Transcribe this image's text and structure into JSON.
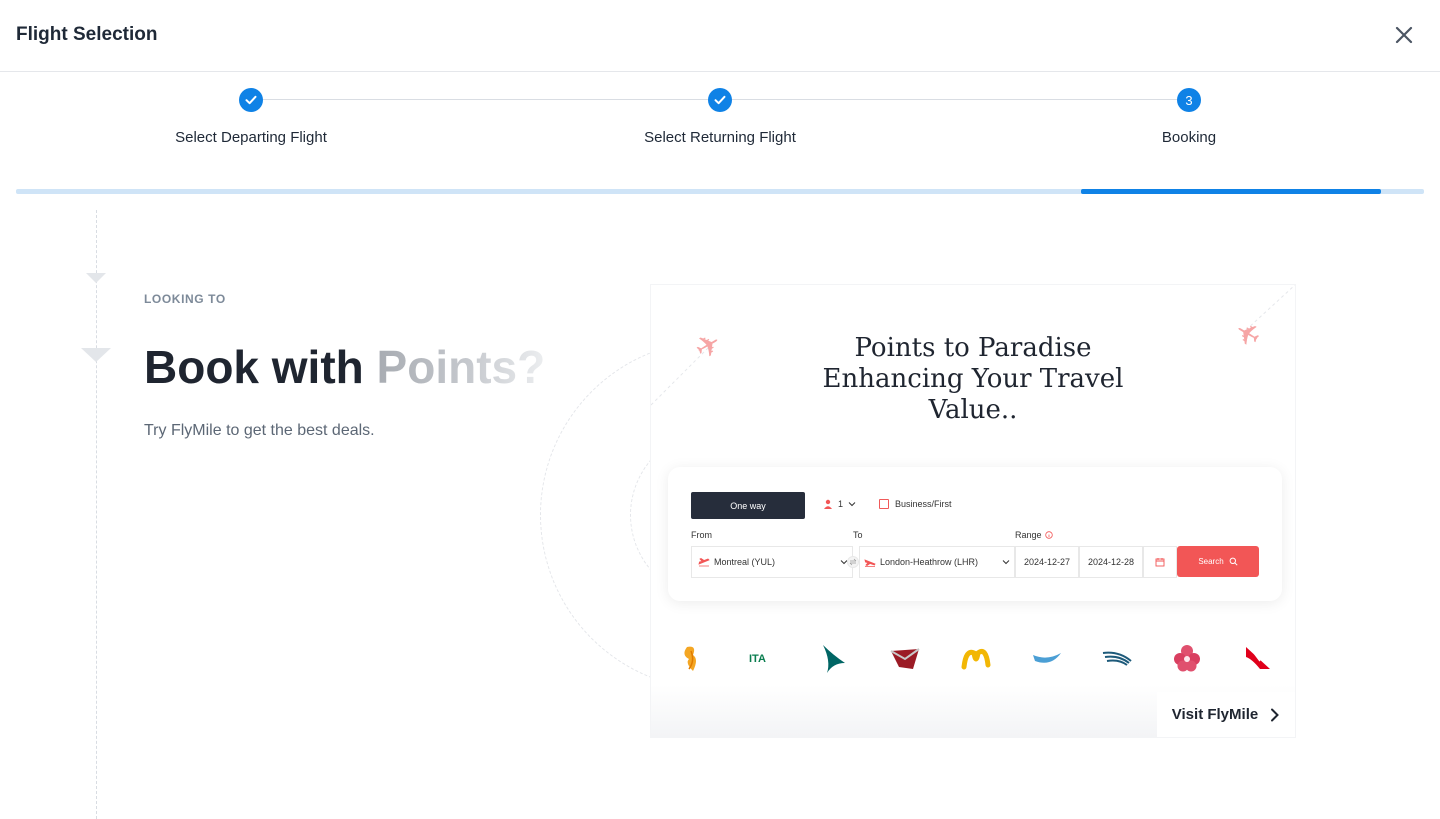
{
  "header": {
    "title": "Flight Selection",
    "close_icon": "close-icon"
  },
  "stepper": {
    "steps": [
      {
        "label": "Select Departing Flight",
        "state": "completed",
        "icon": "check-icon"
      },
      {
        "label": "Select Returning Flight",
        "state": "completed",
        "icon": "check-icon"
      },
      {
        "number": "3",
        "label": "Booking",
        "state": "active"
      }
    ],
    "accent": "#0f82e6"
  },
  "hero": {
    "eyebrow": "LOOKING TO",
    "headline_main": "Book with ",
    "headline_faded": "Points?",
    "subtitle": "Try FlyMile to get the best deals."
  },
  "promo": {
    "title": "Points to Paradise Enhancing Your Travel Value..",
    "widget": {
      "trip_type": "One way",
      "passengers": "1",
      "cabin_option": "Business/First",
      "from_label": "From",
      "to_label": "To",
      "range_label": "Range",
      "from_value": "Montreal (YUL)",
      "to_value": "London-Heathrow (LHR)",
      "date_start": "2024-12-27",
      "date_end": "2024-12-28",
      "search_label": "Search"
    },
    "airline_logos": [
      "singapore-airlines-logo",
      "ita-airways-logo",
      "cathay-pacific-logo",
      "virgin-australia-logo",
      "malaysia-airlines-logo",
      "korean-air-logo",
      "garuda-logo",
      "china-airlines-logo",
      "qantas-logo"
    ],
    "cta": "Visit FlyMile",
    "brand_red": "#f25656"
  }
}
